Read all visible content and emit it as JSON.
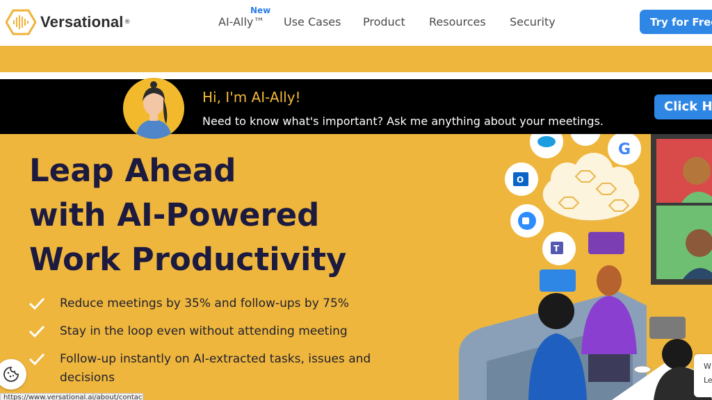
{
  "brand": {
    "name": "Versational",
    "reg": "®"
  },
  "nav": {
    "new_badge": "New",
    "items": [
      "AI-Ally™",
      "Use Cases",
      "Product",
      "Resources",
      "Security"
    ],
    "cta": "Try for Free"
  },
  "banner": {
    "title": "Hi, I'm AI-Ally!",
    "subtitle": "Need to know what's important? Ask me anything about your meetings.",
    "button": "Click Here"
  },
  "hero": {
    "headline": [
      "Leap Ahead",
      "with AI-Powered",
      "Work Productivity"
    ],
    "bullets": [
      "Reduce meetings by 35% and follow-ups by 75%",
      "Stay in the loop even without attending meeting",
      "Follow-up instantly on AI-extracted tasks, issues and decisions"
    ]
  },
  "chat_card": {
    "line1": "W",
    "line2": "Le"
  },
  "status_bar": {
    "url": "https://www.versational.ai/about/contact-us"
  },
  "colors": {
    "accent": "#efb63d",
    "brand_blue": "#2e86e5",
    "headline": "#1c1a3f",
    "banner_bg": "#000000"
  },
  "icons": [
    "logo-hexagon-icon",
    "check-icon",
    "cookie-icon",
    "salesforce-icon",
    "google-icon",
    "outlook-icon",
    "zoom-icon",
    "teams-icon",
    "cloud-icon"
  ]
}
